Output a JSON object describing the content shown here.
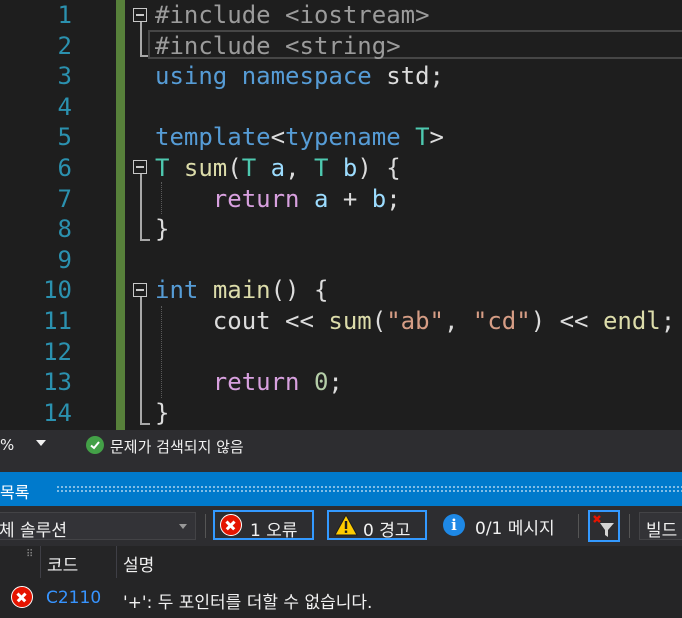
{
  "editor": {
    "line_numbers": [
      "1",
      "2",
      "3",
      "4",
      "5",
      "6",
      "7",
      "8",
      "9",
      "10",
      "11",
      "12",
      "13",
      "14"
    ],
    "lines": [
      [
        {
          "t": "#include ",
          "c": "pp"
        },
        {
          "t": "<iostream>",
          "c": "pp"
        }
      ],
      [
        {
          "t": "#include ",
          "c": "pp"
        },
        {
          "t": "<string>",
          "c": "pp"
        }
      ],
      [
        {
          "t": "using",
          "c": "kw"
        },
        {
          "t": " ",
          "c": ""
        },
        {
          "t": "namespace",
          "c": "kw"
        },
        {
          "t": " std;",
          "c": ""
        }
      ],
      [],
      [
        {
          "t": "template",
          "c": "kw"
        },
        {
          "t": "<",
          "c": ""
        },
        {
          "t": "typename",
          "c": "kw"
        },
        {
          "t": " ",
          "c": ""
        },
        {
          "t": "T",
          "c": "tp"
        },
        {
          "t": ">",
          "c": ""
        }
      ],
      [
        {
          "t": "T",
          "c": "tp"
        },
        {
          "t": " ",
          "c": ""
        },
        {
          "t": "sum",
          "c": "fn"
        },
        {
          "t": "(",
          "c": ""
        },
        {
          "t": "T",
          "c": "tp"
        },
        {
          "t": " ",
          "c": ""
        },
        {
          "t": "a",
          "c": "par"
        },
        {
          "t": ", ",
          "c": ""
        },
        {
          "t": "T",
          "c": "tp"
        },
        {
          "t": " ",
          "c": ""
        },
        {
          "t": "b",
          "c": "par"
        },
        {
          "t": ") {",
          "c": ""
        }
      ],
      [
        {
          "t": "    ",
          "c": ""
        },
        {
          "t": "return",
          "c": "ctl"
        },
        {
          "t": " ",
          "c": ""
        },
        {
          "t": "a",
          "c": "par"
        },
        {
          "t": " + ",
          "c": ""
        },
        {
          "t": "b",
          "c": "par"
        },
        {
          "t": ";",
          "c": ""
        }
      ],
      [
        {
          "t": "}",
          "c": ""
        }
      ],
      [],
      [
        {
          "t": "int",
          "c": "kw"
        },
        {
          "t": " ",
          "c": ""
        },
        {
          "t": "main",
          "c": "fn"
        },
        {
          "t": "() {",
          "c": ""
        }
      ],
      [
        {
          "t": "    cout << ",
          "c": ""
        },
        {
          "t": "sum",
          "c": "fn"
        },
        {
          "t": "(",
          "c": ""
        },
        {
          "t": "\"ab\"",
          "c": "str"
        },
        {
          "t": ", ",
          "c": ""
        },
        {
          "t": "\"cd\"",
          "c": "str"
        },
        {
          "t": ") << ",
          "c": ""
        },
        {
          "t": "endl",
          "c": "fn"
        },
        {
          "t": ";",
          "c": ""
        }
      ],
      [],
      [
        {
          "t": "    ",
          "c": ""
        },
        {
          "t": "return",
          "c": "ctl"
        },
        {
          "t": " ",
          "c": ""
        },
        {
          "t": "0",
          "c": "num"
        },
        {
          "t": ";",
          "c": ""
        }
      ],
      [
        {
          "t": "}",
          "c": ""
        }
      ]
    ]
  },
  "status": {
    "zoom": "%",
    "issues_text": "문제가 검색되지 않음"
  },
  "error_list": {
    "title": "목록",
    "scope": "체 솔루션",
    "errors_label": "1 오류",
    "warnings_label": "0 경고",
    "messages_label": "0/1 메시지",
    "build_label": "빌드",
    "col_code": "코드",
    "col_desc": "설명",
    "rows": [
      {
        "code": "C2110",
        "desc": "'+': 두 포인터를 더할 수 없습니다."
      }
    ]
  },
  "colors": {
    "accent": "#007acc",
    "error": "#e51400",
    "warning": "#ffcc00",
    "info": "#1e88e5",
    "ok": "#43a047"
  }
}
